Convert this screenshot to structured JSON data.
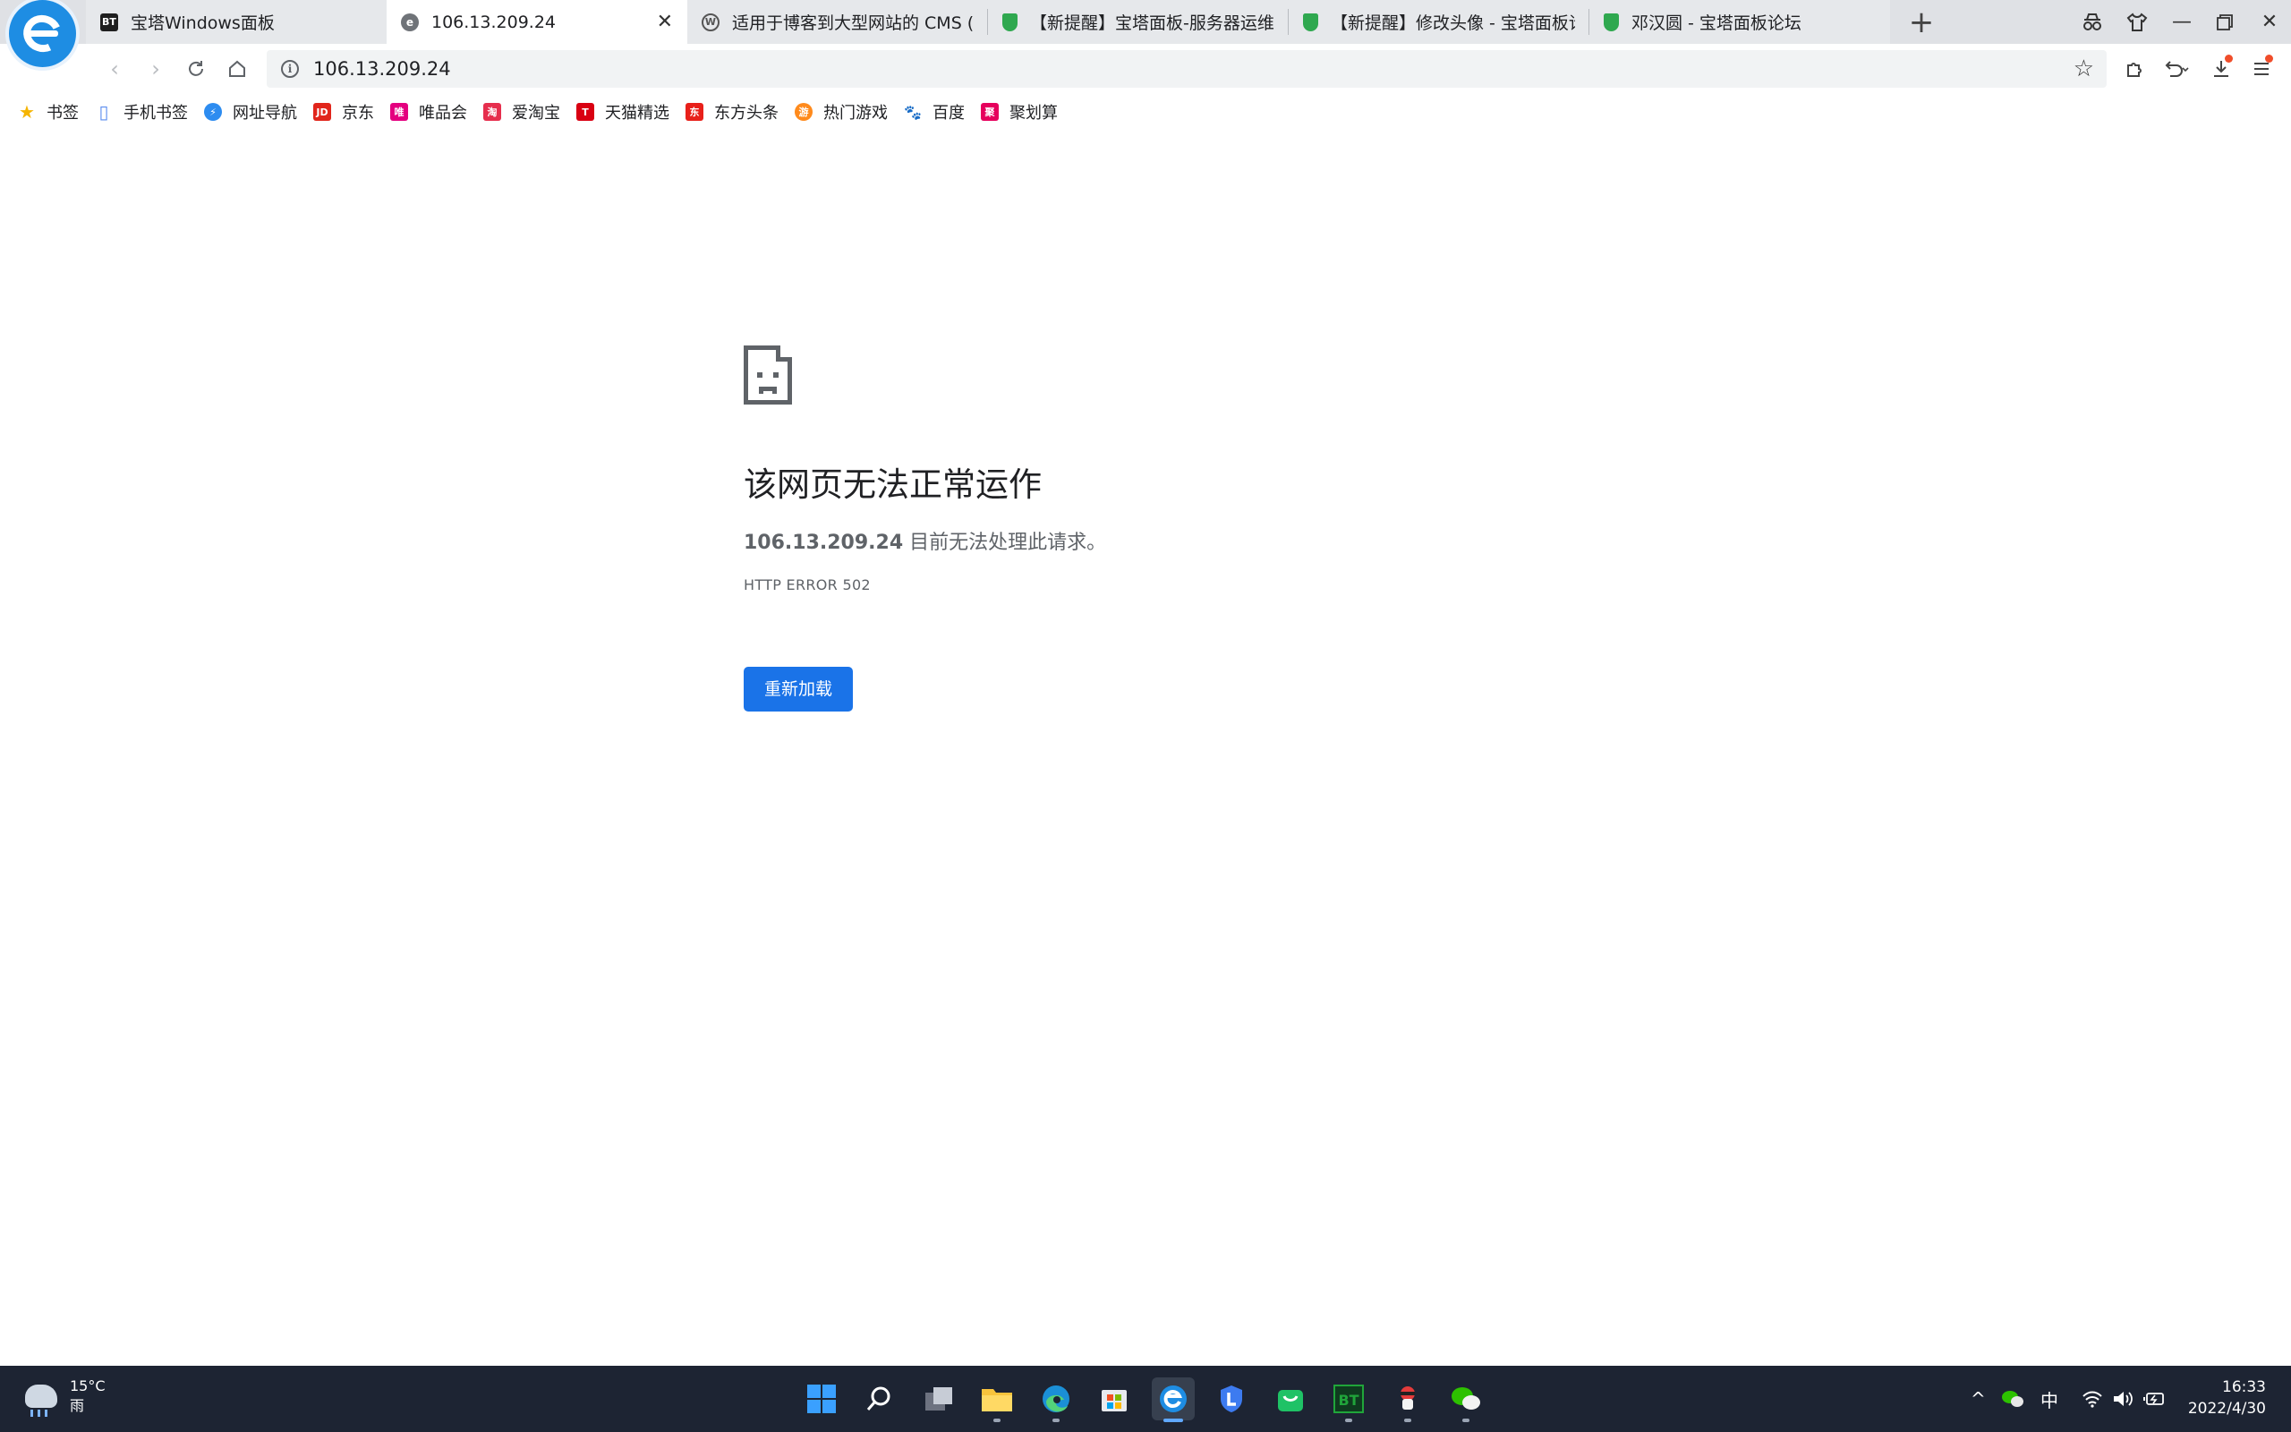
{
  "tabs": [
    {
      "title": "宝塔Windows面板",
      "favicon": "bt-icon",
      "active": false
    },
    {
      "title": "106.13.209.24",
      "favicon": "browser-360-icon",
      "active": true
    },
    {
      "title": "适用于博客到大型网站的 CMS (P",
      "favicon": "wordpress-icon",
      "active": false
    },
    {
      "title": "【新提醒】宝塔面板-服务器运维",
      "favicon": "shield-icon",
      "active": false
    },
    {
      "title": "【新提醒】修改头像 - 宝塔面板论",
      "favicon": "shield-icon",
      "active": false
    },
    {
      "title": "邓汉圆 - 宝塔面板论坛",
      "favicon": "shield-icon",
      "active": false
    }
  ],
  "address_bar": {
    "url": "106.13.209.24"
  },
  "bookmarks": [
    {
      "label": "书签",
      "icon": "star-icon",
      "color": "#f5b400",
      "glyph": "★"
    },
    {
      "label": "手机书签",
      "icon": "phone-icon",
      "color": "#5b8def",
      "glyph": "▯"
    },
    {
      "label": "网址导航",
      "icon": "nav-icon",
      "color": "#2d8cf0",
      "glyph": "⚡"
    },
    {
      "label": "京东",
      "icon": "jd-icon",
      "color": "#e1251b",
      "glyph": "JD"
    },
    {
      "label": "唯品会",
      "icon": "vip-icon",
      "color": "#e4007f",
      "glyph": "唯"
    },
    {
      "label": "爱淘宝",
      "icon": "taobao-icon",
      "color": "#e62e4d",
      "glyph": "淘"
    },
    {
      "label": "天猫精选",
      "icon": "tmall-icon",
      "color": "#d90012",
      "glyph": "T"
    },
    {
      "label": "东方头条",
      "icon": "toutiao-icon",
      "color": "#e8201a",
      "glyph": "东"
    },
    {
      "label": "热门游戏",
      "icon": "game-icon",
      "color": "#ff8a1c",
      "glyph": "游"
    },
    {
      "label": "百度",
      "icon": "baidu-icon",
      "color": "#2932e1",
      "glyph": "🐾"
    },
    {
      "label": "聚划算",
      "icon": "juhuasuan-icon",
      "color": "#e6005c",
      "glyph": "聚"
    }
  ],
  "error_page": {
    "title": "该网页无法正常运作",
    "host": "106.13.209.24",
    "message": "目前无法处理此请求。",
    "code": "HTTP ERROR 502",
    "reload_label": "重新加载"
  },
  "taskbar": {
    "weather_temp": "15°C",
    "weather_desc": "雨",
    "ime": "中",
    "time": "16:33",
    "date": "2022/4/30"
  },
  "colors": {
    "accent": "#1a73e8",
    "taskbar": "#1d2433"
  }
}
